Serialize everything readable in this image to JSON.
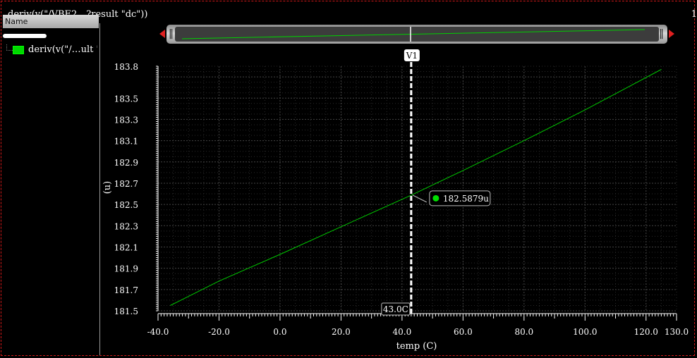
{
  "window": {
    "title": "deriv(v(\"/VBE2…?result \"dc\"))",
    "corner_label": "1"
  },
  "sidebar": {
    "header": "Name",
    "legend_label": "deriv(v(\"/…ult \"dc",
    "legend_color": "#00d800"
  },
  "marker": {
    "name": "V1",
    "x": 43.0,
    "x_label": "43.0C",
    "value_label": "182.5879u",
    "y": 182.5879
  },
  "chart_data": {
    "type": "line",
    "xlabel": "temp (C)",
    "ylabel": "(u)",
    "xlim": [
      -40,
      130
    ],
    "ylim": [
      181.5,
      183.8
    ],
    "x_ticks": [
      -40,
      -20,
      0,
      20,
      40,
      60,
      80,
      100,
      120,
      130
    ],
    "x_tick_labels": [
      "-40.0",
      "-20.0",
      "0.0",
      "20.0",
      "40.0",
      "60.0",
      "80.0",
      "100.0",
      "120.0",
      "130.0"
    ],
    "y_ticks": [
      181.5,
      181.7,
      181.9,
      182.1,
      182.3,
      182.5,
      182.7,
      182.9,
      183.1,
      183.3,
      183.5,
      183.8
    ],
    "y_tick_labels": [
      "181.5",
      "181.7",
      "181.9",
      "182.1",
      "182.3",
      "182.5",
      "182.7",
      "182.9",
      "183.1",
      "183.3",
      "183.5",
      "183.8"
    ],
    "grid": true,
    "series": [
      {
        "color": "#00c800",
        "x": [
          -36,
          -20,
          0,
          20,
          43,
          60,
          80,
          100,
          125
        ],
        "y": [
          181.55,
          181.78,
          182.03,
          182.29,
          182.5879,
          182.82,
          183.1,
          183.39,
          183.77
        ]
      }
    ]
  }
}
